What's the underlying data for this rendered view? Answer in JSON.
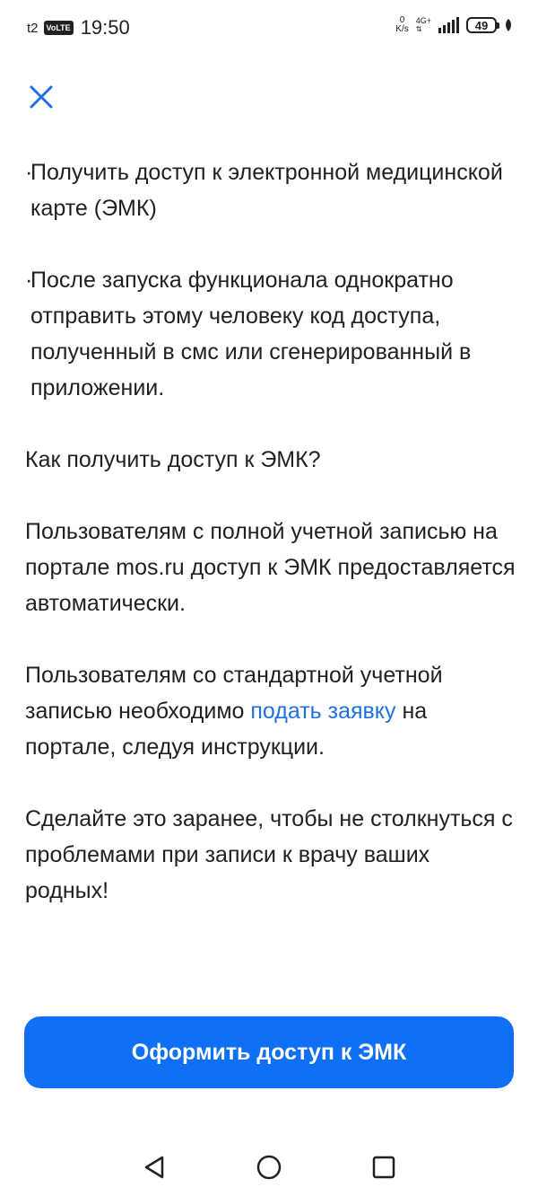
{
  "status_bar": {
    "carrier": "t2",
    "volte": "VoLTE",
    "time": "19:50",
    "net_speed_value": "0",
    "net_speed_unit": "K/s",
    "net_type": "4G+",
    "battery": "49"
  },
  "content": {
    "bullet_1": "Получить доступ к электронной медицинской карте (ЭМК)",
    "bullet_2": "После запуска функционала однократно отправить этому человеку код доступа, полученный в смс или сгенерированный в приложении.",
    "question": "Как получить доступ к ЭМК?",
    "full_account": "Пользователям с полной учетной записью на портале mos.ru доступ к ЭМК предоставляется автоматически.",
    "standard_account_before": "Пользователям со стандартной учетной записью необходимо ",
    "standard_account_link": "подать заявку",
    "standard_account_after": " на портале, следуя инструкции.",
    "advice": "Сделайте это заранее, чтобы не столкнуться с проблемами при записи к врачу ваших родных!"
  },
  "primary_button": {
    "label": "Оформить доступ к ЭМК"
  },
  "colors": {
    "accent": "#0f6ff5",
    "link": "#1f6fe5",
    "text": "#202124"
  },
  "icons": {
    "close": "close-icon",
    "nav_back": "triangle-back-icon",
    "nav_home": "circle-home-icon",
    "nav_recents": "square-recents-icon"
  }
}
